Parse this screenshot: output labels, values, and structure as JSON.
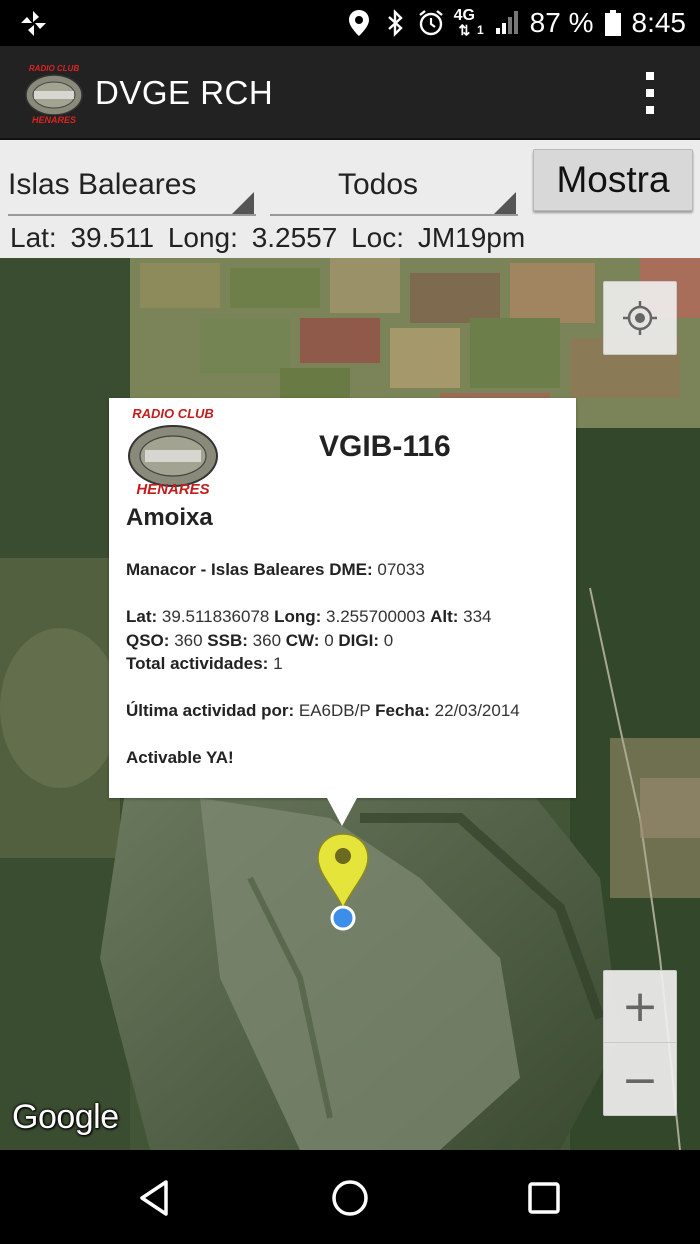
{
  "status_bar": {
    "battery": "87 %",
    "time": "8:45",
    "network": "4G",
    "sim": "1",
    "icons": [
      "pinwheel-icon",
      "location-icon",
      "bluetooth-icon",
      "alarm-icon",
      "network-4g-icon",
      "signal-icon",
      "battery-icon"
    ]
  },
  "app_bar": {
    "title": "DVGE RCH",
    "logo_top": "RADIO CLUB",
    "logo_bottom": "HENARES",
    "menu_icon": "overflow-menu-icon"
  },
  "filters": {
    "region": "Islas Baleares",
    "type": "Todos",
    "show_button": "Mostra"
  },
  "coords": {
    "lat_label": "Lat:",
    "lat": "39.511",
    "long_label": "Long:",
    "long": "3.2557",
    "loc_label": "Loc:",
    "loc": "JM19pm"
  },
  "map": {
    "attribution": "Google",
    "my_location_icon": "my-location-icon",
    "zoom_in": "+",
    "zoom_out": "−"
  },
  "info_window": {
    "logo_top": "RADIO CLUB",
    "logo_bottom": "HENARES",
    "code": "VGIB-116",
    "name": "Amoixa",
    "place": "Manacor - Islas Baleares",
    "dme_label": "DME:",
    "dme": "07033",
    "lat_label": "Lat:",
    "lat": "39.511836078",
    "long_label": "Long:",
    "long": "3.255700003",
    "alt_label": "Alt:",
    "alt": "334",
    "qso_label": "QSO:",
    "qso": "360",
    "ssb_label": "SSB:",
    "ssb": "360",
    "cw_label": "CW:",
    "cw": "0",
    "digi_label": "DIGI:",
    "digi": "0",
    "total_label": "Total actividades:",
    "total": "1",
    "last_label": "Última actividad por:",
    "last_by": "EA6DB/P",
    "date_label": "Fecha:",
    "date": "22/03/2014",
    "status": "Activable YA!"
  },
  "nav_bar": {
    "icons": [
      "back-icon",
      "home-icon",
      "recents-icon"
    ]
  },
  "colors": {
    "app_bar": "#222222",
    "panel": "#ececec",
    "marker": "#e4e43a",
    "location_dot": "#3d8ee8",
    "logo_red": "#b81d1d"
  }
}
